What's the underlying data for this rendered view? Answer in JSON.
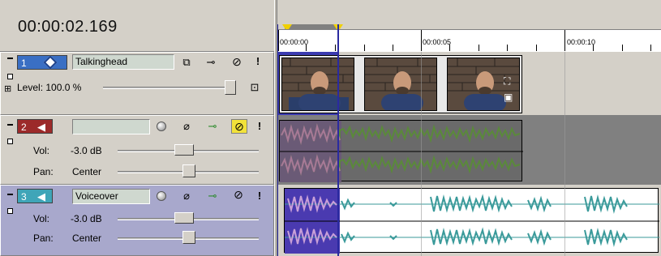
{
  "timecode": "00:00:02.169",
  "ruler": {
    "labels": [
      "00:00:00",
      "00:00:05",
      "00:00:10"
    ]
  },
  "tracks": [
    {
      "number": "1",
      "name": "Talkinghead",
      "type": "video",
      "level_label": "Level: 100.0 %",
      "level_value": 1.0,
      "color": "#3a6fc4"
    },
    {
      "number": "2",
      "name": "",
      "type": "audio",
      "vol_label": "Vol:",
      "vol_value": "-3.0 dB",
      "pan_label": "Pan:",
      "pan_value": "Center",
      "color": "#9c2a2a"
    },
    {
      "number": "3",
      "name": "Voiceover",
      "type": "audio",
      "vol_label": "Vol:",
      "vol_value": "-3.0 dB",
      "pan_label": "Pan:",
      "pan_value": "Center",
      "color": "#3fa5b8"
    }
  ],
  "colors": {
    "selection": "#3b3bb0",
    "audio_green": "#5a8a3a",
    "audio_pink": "#a87898",
    "voice_teal": "#3a9a9a",
    "loop_region": "#808080",
    "marker_yellow": "#f0d000"
  },
  "icons": {
    "video_track": "diamond-icon",
    "audio_track": "speaker-icon",
    "mute": "no-icon",
    "solo": "exclamation-icon",
    "fx": "plug-icon",
    "bypass": "circle-icon",
    "automation": "wand-icon",
    "composite": "composite-icon"
  }
}
